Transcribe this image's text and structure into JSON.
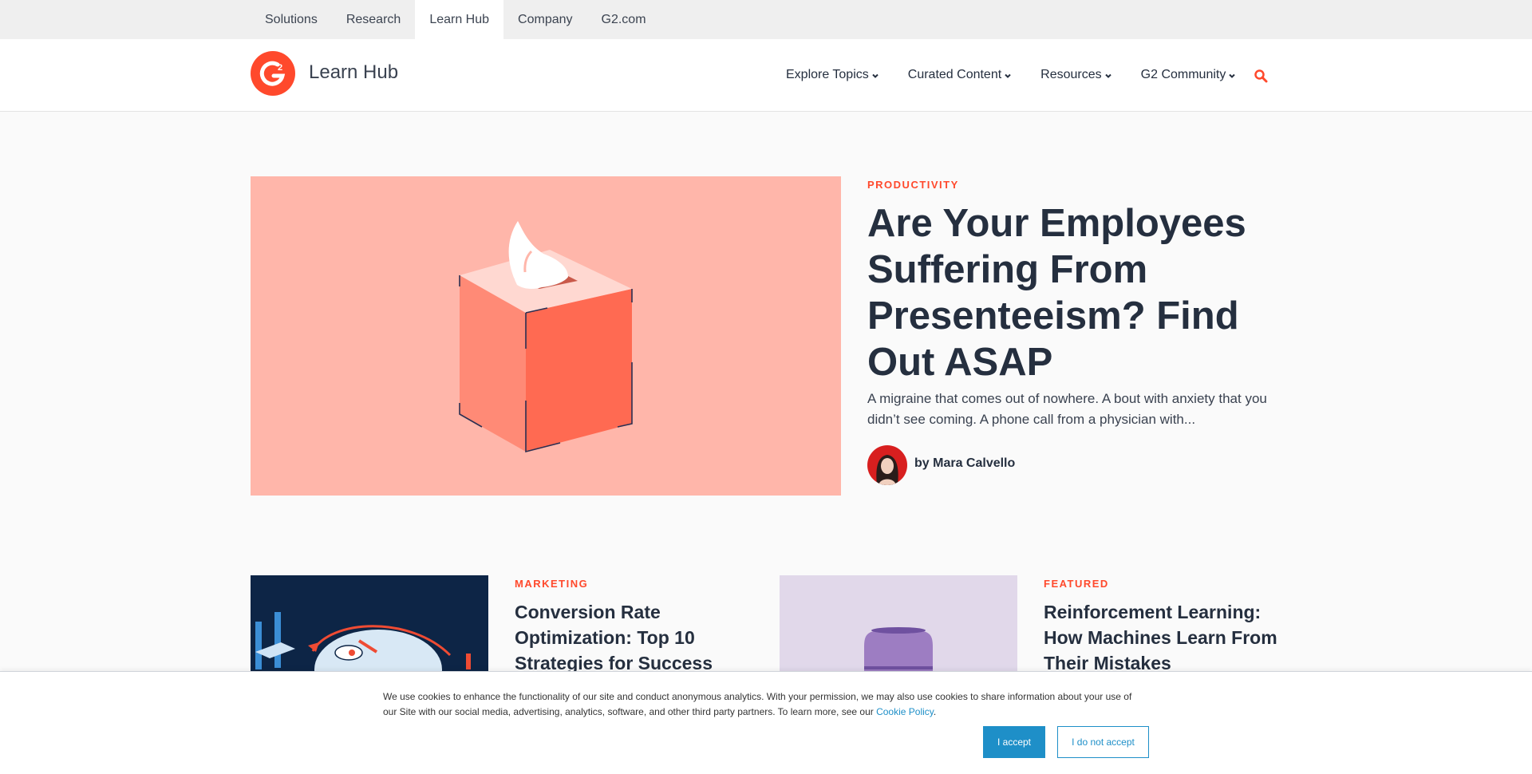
{
  "top_nav": {
    "tabs": [
      {
        "label": "Solutions"
      },
      {
        "label": "Research"
      },
      {
        "label": "Learn Hub",
        "active": true
      },
      {
        "label": "Company"
      },
      {
        "label": "G2.com"
      }
    ]
  },
  "header": {
    "logo_text": "G2",
    "site_title": "Learn Hub",
    "nav": [
      {
        "label": "Explore Topics",
        "icon": "chevron-down-icon"
      },
      {
        "label": "Curated Content",
        "icon": "chevron-down-icon"
      },
      {
        "label": "Resources",
        "icon": "chevron-down-icon"
      },
      {
        "label": "G2 Community",
        "icon": "chevron-down-icon"
      }
    ],
    "search_icon": "search-icon"
  },
  "hero": {
    "category": "PRODUCTIVITY",
    "title": "Are Your Employees Suffering From Presenteeism? Find Out ASAP",
    "excerpt": "A migraine that comes out of nowhere. A bout with anxiety that you didn’t see coming. A phone call from a physician with...",
    "author": "by Mara Calvello"
  },
  "cards": [
    {
      "category": "MARKETING",
      "title": "Conversion Rate Optimization: Top 10 Strategies for Success"
    },
    {
      "category": "FEATURED",
      "title": "Reinforcement Learning: How Machines Learn From Their Mistakes"
    }
  ],
  "cookie_banner": {
    "text": "We use cookies to enhance the functionality of our site and conduct anonymous analytics. With your permission, we may also use cookies to share information about your use of our Site with our social media, advertising, analytics, software, and other third party partners. To learn more, see our ",
    "link_text": "Cookie Policy",
    "text_end": ".",
    "accept_label": "I accept",
    "decline_label": "I do not accept"
  },
  "colors": {
    "brand": "#ff492c",
    "text_dark": "#252f3f",
    "cookie_blue": "#1e8fc8",
    "hero_bg": "#ffb6aa"
  }
}
